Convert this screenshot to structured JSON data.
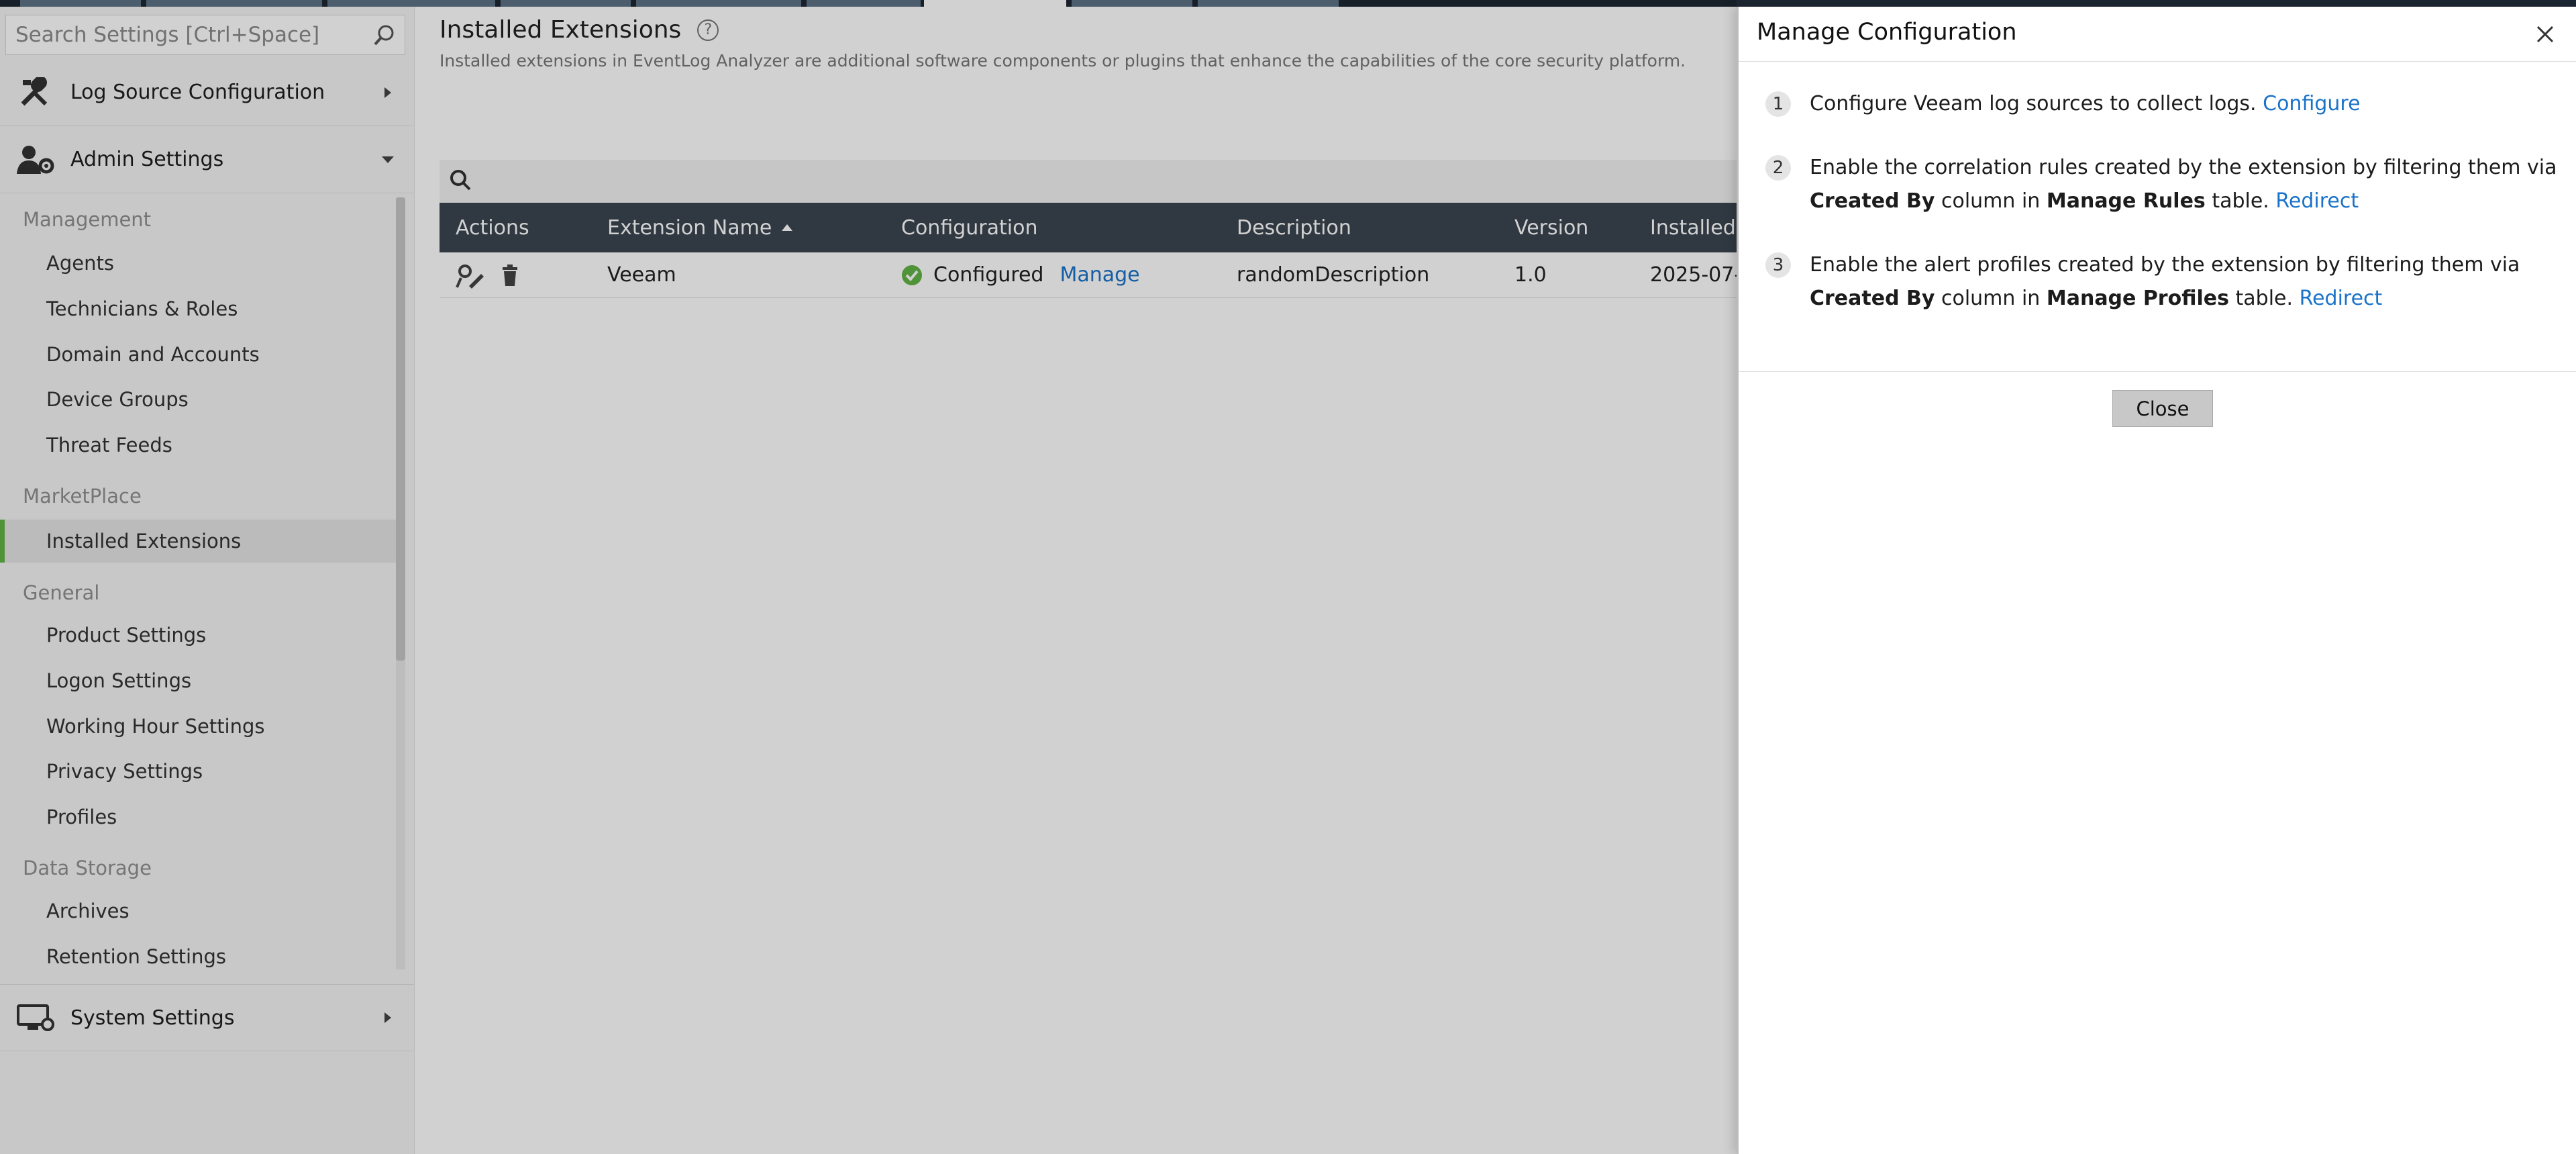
{
  "sidebar": {
    "search_placeholder": "Search Settings [Ctrl+Space]",
    "sections": [
      {
        "label": "Log Source Configuration",
        "icon": "tools-icon",
        "expanded": false
      },
      {
        "label": "Admin Settings",
        "icon": "admin-user-gear-icon",
        "expanded": true
      },
      {
        "label": "System Settings",
        "icon": "monitor-gear-icon",
        "expanded": false
      }
    ],
    "groups": {
      "management": "Management",
      "marketplace": "MarketPlace",
      "general": "General",
      "data_storage": "Data Storage"
    },
    "items": {
      "agents": "Agents",
      "technicians": "Technicians & Roles",
      "domain": "Domain and Accounts",
      "device_groups": "Device Groups",
      "threat_feeds": "Threat Feeds",
      "installed_extensions": "Installed Extensions",
      "product_settings": "Product Settings",
      "logon_settings": "Logon Settings",
      "working_hour": "Working Hour Settings",
      "privacy": "Privacy Settings",
      "profiles": "Profiles",
      "archives": "Archives",
      "retention": "Retention Settings"
    },
    "active_item": "Installed Extensions"
  },
  "main": {
    "title": "Installed Extensions",
    "subtitle": "Installed extensions in EventLog Analyzer are additional software components or plugins that enhance the capabilities of the core security platform.",
    "columns": {
      "actions": "Actions",
      "name": "Extension Name",
      "configuration": "Configuration",
      "description": "Description",
      "version": "Version",
      "installed": "Installed"
    },
    "row": {
      "name": "Veeam",
      "status": "Configured",
      "manage": "Manage",
      "description": "randomDescription",
      "version": "1.0",
      "installed": "2025-07-"
    }
  },
  "drawer": {
    "title": "Manage Configuration",
    "steps": [
      {
        "num": "1",
        "text": "Configure Veeam log sources to collect logs.",
        "link": "Configure"
      },
      {
        "num": "2",
        "pre": "Enable the correlation rules created by the extension by filtering them via",
        "b1": "Created By",
        "mid": "column in",
        "b2": "Manage Rules",
        "post": "table.",
        "link": "Redirect"
      },
      {
        "num": "3",
        "pre": "Enable the alert profiles created by the extension by filtering them via",
        "b1": "Created By",
        "mid": "column in",
        "b2": "Manage Profiles",
        "post": "table.",
        "link": "Redirect"
      }
    ],
    "close_label": "Close"
  },
  "colors": {
    "accent_green": "#62b445",
    "link_blue": "#1a73c9",
    "table_header": "#3b4550"
  }
}
